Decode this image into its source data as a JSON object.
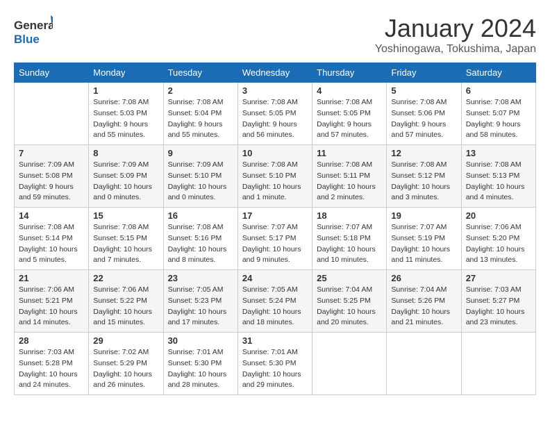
{
  "header": {
    "logo_line1": "General",
    "logo_line2": "Blue",
    "month_year": "January 2024",
    "location": "Yoshinogawa, Tokushima, Japan"
  },
  "days_of_week": [
    "Sunday",
    "Monday",
    "Tuesday",
    "Wednesday",
    "Thursday",
    "Friday",
    "Saturday"
  ],
  "weeks": [
    [
      {
        "num": "",
        "info": ""
      },
      {
        "num": "1",
        "info": "Sunrise: 7:08 AM\nSunset: 5:03 PM\nDaylight: 9 hours\nand 55 minutes."
      },
      {
        "num": "2",
        "info": "Sunrise: 7:08 AM\nSunset: 5:04 PM\nDaylight: 9 hours\nand 55 minutes."
      },
      {
        "num": "3",
        "info": "Sunrise: 7:08 AM\nSunset: 5:05 PM\nDaylight: 9 hours\nand 56 minutes."
      },
      {
        "num": "4",
        "info": "Sunrise: 7:08 AM\nSunset: 5:05 PM\nDaylight: 9 hours\nand 57 minutes."
      },
      {
        "num": "5",
        "info": "Sunrise: 7:08 AM\nSunset: 5:06 PM\nDaylight: 9 hours\nand 57 minutes."
      },
      {
        "num": "6",
        "info": "Sunrise: 7:08 AM\nSunset: 5:07 PM\nDaylight: 9 hours\nand 58 minutes."
      }
    ],
    [
      {
        "num": "7",
        "info": "Sunrise: 7:09 AM\nSunset: 5:08 PM\nDaylight: 9 hours\nand 59 minutes."
      },
      {
        "num": "8",
        "info": "Sunrise: 7:09 AM\nSunset: 5:09 PM\nDaylight: 10 hours\nand 0 minutes."
      },
      {
        "num": "9",
        "info": "Sunrise: 7:09 AM\nSunset: 5:10 PM\nDaylight: 10 hours\nand 0 minutes."
      },
      {
        "num": "10",
        "info": "Sunrise: 7:08 AM\nSunset: 5:10 PM\nDaylight: 10 hours\nand 1 minute."
      },
      {
        "num": "11",
        "info": "Sunrise: 7:08 AM\nSunset: 5:11 PM\nDaylight: 10 hours\nand 2 minutes."
      },
      {
        "num": "12",
        "info": "Sunrise: 7:08 AM\nSunset: 5:12 PM\nDaylight: 10 hours\nand 3 minutes."
      },
      {
        "num": "13",
        "info": "Sunrise: 7:08 AM\nSunset: 5:13 PM\nDaylight: 10 hours\nand 4 minutes."
      }
    ],
    [
      {
        "num": "14",
        "info": "Sunrise: 7:08 AM\nSunset: 5:14 PM\nDaylight: 10 hours\nand 5 minutes."
      },
      {
        "num": "15",
        "info": "Sunrise: 7:08 AM\nSunset: 5:15 PM\nDaylight: 10 hours\nand 7 minutes."
      },
      {
        "num": "16",
        "info": "Sunrise: 7:08 AM\nSunset: 5:16 PM\nDaylight: 10 hours\nand 8 minutes."
      },
      {
        "num": "17",
        "info": "Sunrise: 7:07 AM\nSunset: 5:17 PM\nDaylight: 10 hours\nand 9 minutes."
      },
      {
        "num": "18",
        "info": "Sunrise: 7:07 AM\nSunset: 5:18 PM\nDaylight: 10 hours\nand 10 minutes."
      },
      {
        "num": "19",
        "info": "Sunrise: 7:07 AM\nSunset: 5:19 PM\nDaylight: 10 hours\nand 11 minutes."
      },
      {
        "num": "20",
        "info": "Sunrise: 7:06 AM\nSunset: 5:20 PM\nDaylight: 10 hours\nand 13 minutes."
      }
    ],
    [
      {
        "num": "21",
        "info": "Sunrise: 7:06 AM\nSunset: 5:21 PM\nDaylight: 10 hours\nand 14 minutes."
      },
      {
        "num": "22",
        "info": "Sunrise: 7:06 AM\nSunset: 5:22 PM\nDaylight: 10 hours\nand 15 minutes."
      },
      {
        "num": "23",
        "info": "Sunrise: 7:05 AM\nSunset: 5:23 PM\nDaylight: 10 hours\nand 17 minutes."
      },
      {
        "num": "24",
        "info": "Sunrise: 7:05 AM\nSunset: 5:24 PM\nDaylight: 10 hours\nand 18 minutes."
      },
      {
        "num": "25",
        "info": "Sunrise: 7:04 AM\nSunset: 5:25 PM\nDaylight: 10 hours\nand 20 minutes."
      },
      {
        "num": "26",
        "info": "Sunrise: 7:04 AM\nSunset: 5:26 PM\nDaylight: 10 hours\nand 21 minutes."
      },
      {
        "num": "27",
        "info": "Sunrise: 7:03 AM\nSunset: 5:27 PM\nDaylight: 10 hours\nand 23 minutes."
      }
    ],
    [
      {
        "num": "28",
        "info": "Sunrise: 7:03 AM\nSunset: 5:28 PM\nDaylight: 10 hours\nand 24 minutes."
      },
      {
        "num": "29",
        "info": "Sunrise: 7:02 AM\nSunset: 5:29 PM\nDaylight: 10 hours\nand 26 minutes."
      },
      {
        "num": "30",
        "info": "Sunrise: 7:01 AM\nSunset: 5:30 PM\nDaylight: 10 hours\nand 28 minutes."
      },
      {
        "num": "31",
        "info": "Sunrise: 7:01 AM\nSunset: 5:30 PM\nDaylight: 10 hours\nand 29 minutes."
      },
      {
        "num": "",
        "info": ""
      },
      {
        "num": "",
        "info": ""
      },
      {
        "num": "",
        "info": ""
      }
    ]
  ]
}
